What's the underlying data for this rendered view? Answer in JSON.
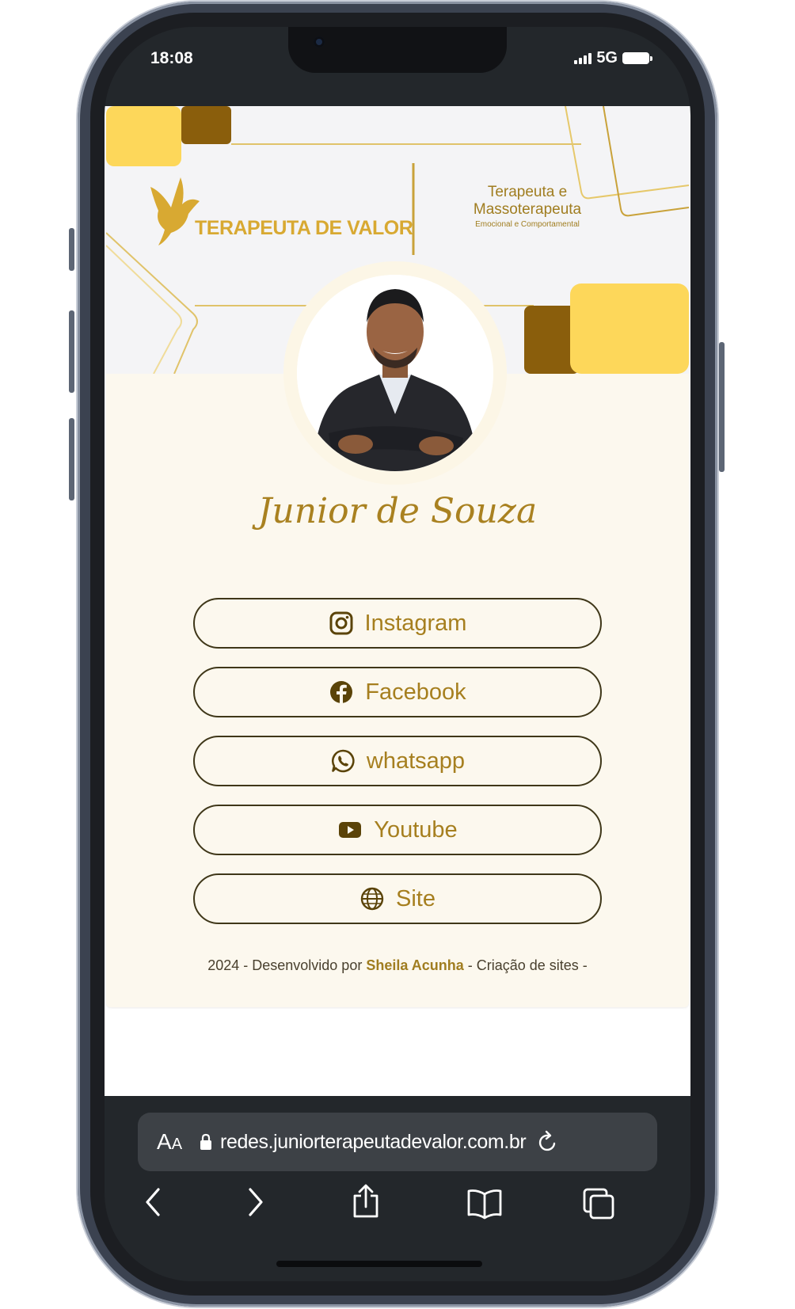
{
  "status_bar": {
    "time": "18:08",
    "network": "5G"
  },
  "banner": {
    "logo_text": "TERAPEUTA DE VALOR",
    "tagline_line1": "Terapeuta e",
    "tagline_line2": "Massoterapeuta",
    "tagline_line3": "Emocional e Comportamental"
  },
  "profile": {
    "name": "Junior de Souza"
  },
  "links": [
    {
      "label": "Instagram",
      "icon": "instagram-icon"
    },
    {
      "label": "Facebook",
      "icon": "facebook-icon"
    },
    {
      "label": "whatsapp",
      "icon": "whatsapp-icon"
    },
    {
      "label": "Youtube",
      "icon": "youtube-icon"
    },
    {
      "label": "Site",
      "icon": "globe-icon"
    }
  ],
  "footer": {
    "prefix": "2024 - Desenvolvido por",
    "author": "Sheila Acunha",
    "suffix": "- Criação de sites -"
  },
  "browser": {
    "text_size_label_big": "A",
    "text_size_label_small": "A",
    "url": "redes.juniorterapeutadevalor.com.br"
  },
  "colors": {
    "accent_gold": "#a67f1f",
    "banner_yellow": "#fdd75a",
    "banner_brown": "#8a5e0c",
    "card_background": "#fcf8ee"
  }
}
